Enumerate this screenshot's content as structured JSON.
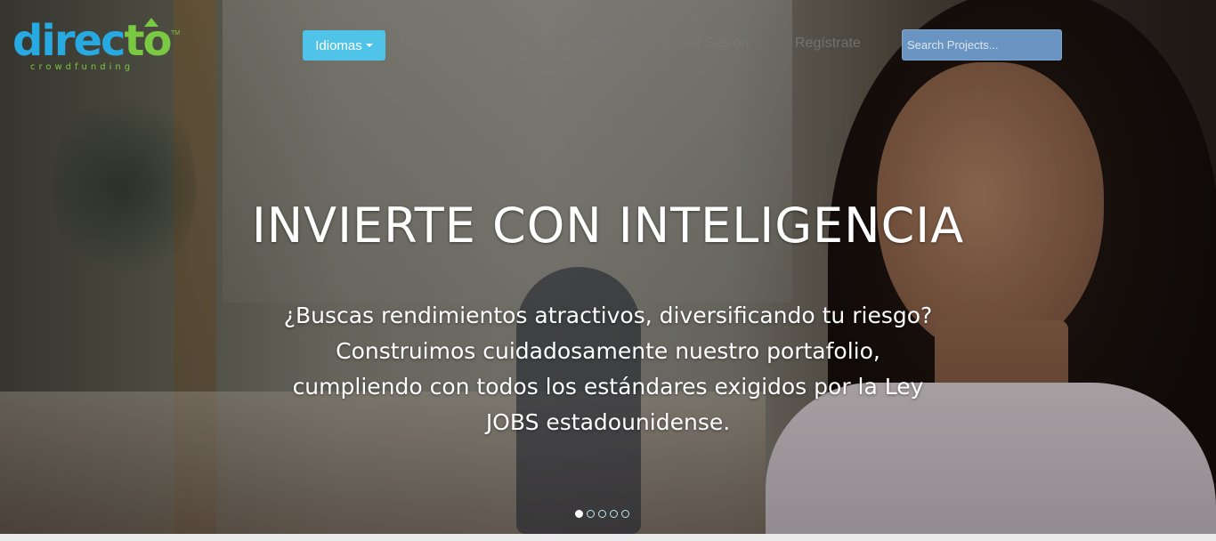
{
  "brand": {
    "logo_main": "direc",
    "logo_accent": "to",
    "logo_tm": "TM",
    "logo_sub": "crowdfunding"
  },
  "nav": {
    "languages_label": "Idiomas",
    "links": [
      "Nosotros",
      "Blog",
      "Proyectos",
      "Iniciar Sesión",
      "Regístrate"
    ],
    "search_placeholder": "Search Projects..."
  },
  "hero": {
    "headline": "INVIERTE CON INTELIGENCIA",
    "lines": [
      "¿Buscas rendimientos atractivos, diversificando tu riesgo?",
      "Construimos cuidadosamente nuestro portafolio,",
      "cumpliendo con todos los estándares exigidos por la Ley",
      "JOBS estadounidense."
    ]
  },
  "carousel": {
    "slide_count": 5,
    "active_index": 0
  },
  "colors": {
    "brand_blue": "#27a9e1",
    "brand_green": "#7ac943",
    "button_blue": "#4fc3e8",
    "search_blue": "#6a95c2"
  }
}
